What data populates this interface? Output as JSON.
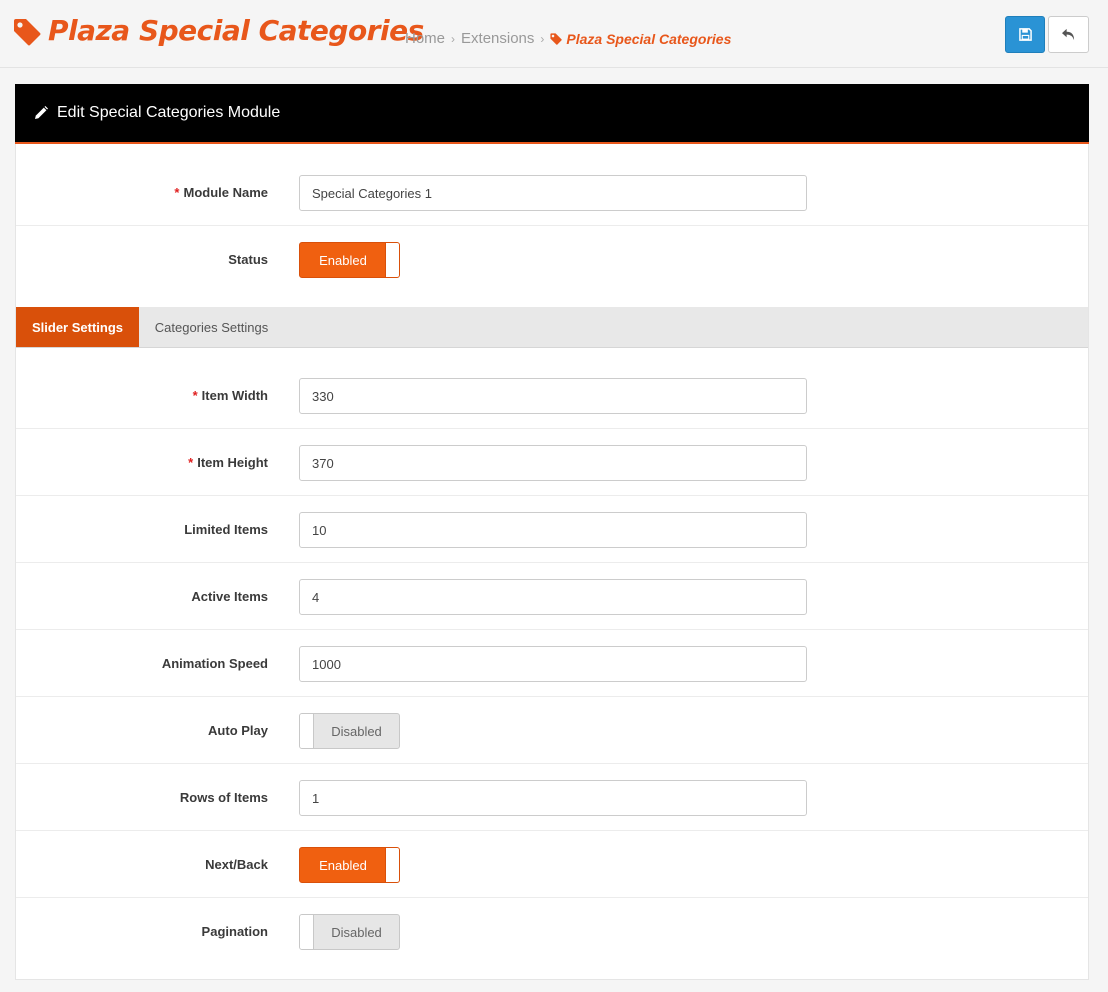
{
  "header": {
    "title": "Plaza Special Categories",
    "breadcrumb": [
      "Home",
      "Extensions",
      "Plaza Special Categories"
    ],
    "save_icon": "save-icon",
    "back_icon": "reply-icon"
  },
  "panel": {
    "heading": "Edit Special Categories Module",
    "module_name": {
      "label": "Module Name",
      "required": "*",
      "value": "Special Categories 1"
    },
    "status": {
      "label": "Status",
      "value": "Enabled"
    }
  },
  "tabs": {
    "active": "Slider Settings",
    "inactive": "Categories Settings"
  },
  "slider": {
    "item_width": {
      "label": "Item Width",
      "required": "*",
      "value": "330"
    },
    "item_height": {
      "label": "Item Height",
      "required": "*",
      "value": "370"
    },
    "limited_items": {
      "label": "Limited Items",
      "value": "10"
    },
    "active_items": {
      "label": "Active Items",
      "value": "4"
    },
    "animation_speed": {
      "label": "Animation Speed",
      "value": "1000"
    },
    "auto_play": {
      "label": "Auto Play",
      "value": "Disabled"
    },
    "rows_of_items": {
      "label": "Rows of Items",
      "value": "1"
    },
    "next_back": {
      "label": "Next/Back",
      "value": "Enabled"
    },
    "pagination": {
      "label": "Pagination",
      "value": "Disabled"
    }
  },
  "colors": {
    "accent": "#e8571b",
    "tab_active": "#d9500a",
    "save_button": "#2a93d5",
    "heading_bg": "#000000"
  }
}
